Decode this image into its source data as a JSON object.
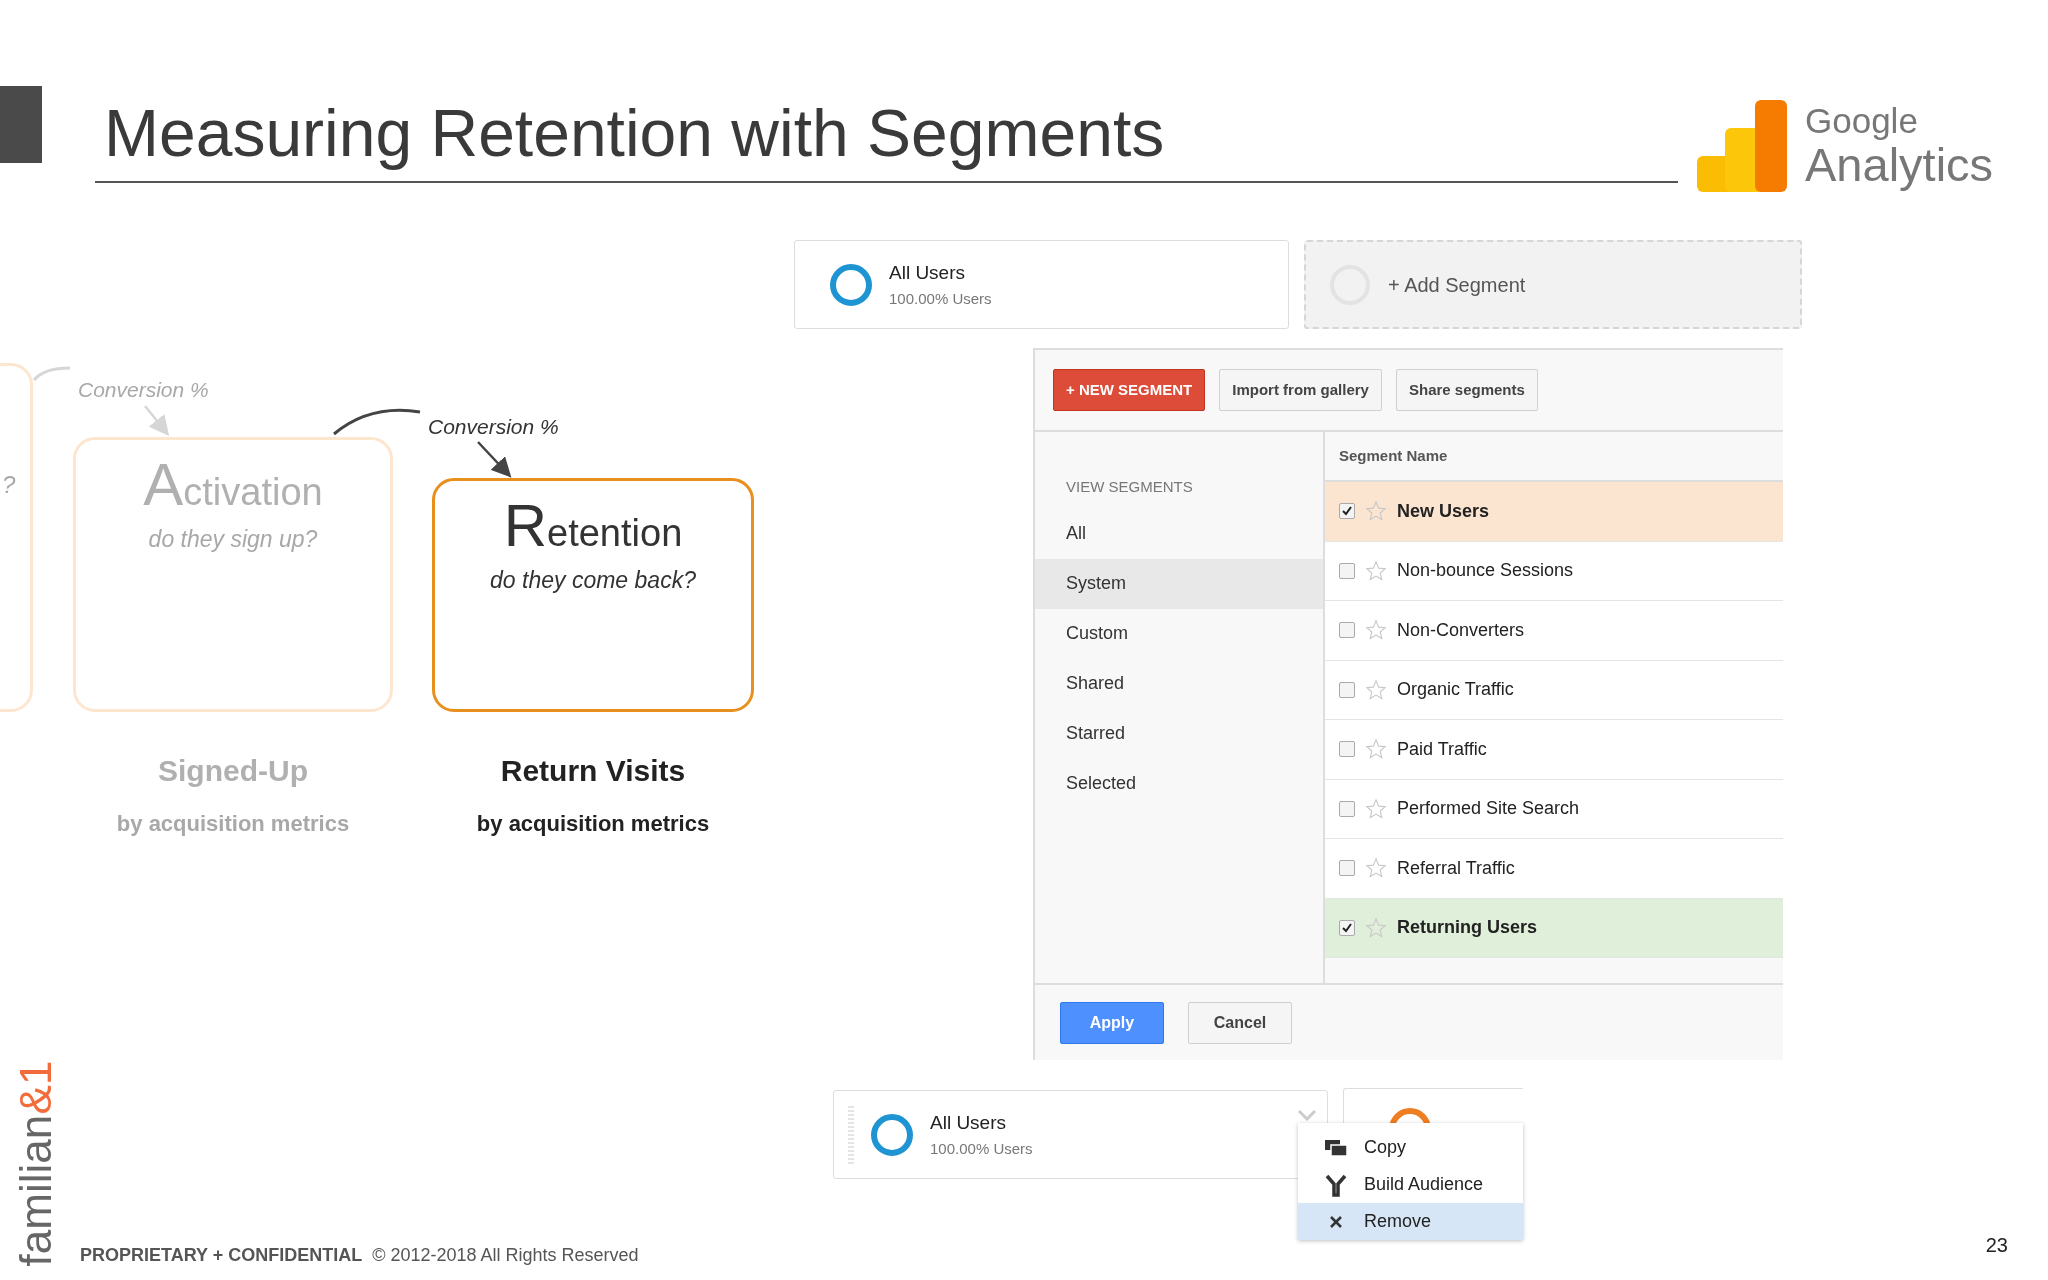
{
  "slide": {
    "title": "Measuring Retention with Segments",
    "page_number": "23",
    "brand": {
      "name": "familian",
      "suffix": "&1"
    },
    "footer": {
      "label": "PROPRIETARY + CONFIDENTIAL",
      "copyright": "© 2012-2018 All Rights Reserved"
    }
  },
  "logo": {
    "line1": "Google",
    "line2": "Analytics"
  },
  "funnel": {
    "edge_text": "?",
    "stages": [
      {
        "title": "Activation",
        "question": "do they sign up?",
        "metric": "Signed-Up",
        "subtitle": "by acquisition metrics",
        "conversion": "Conversion %",
        "faded": true
      },
      {
        "title": "Retention",
        "question": "do they come back?",
        "metric": "Return Visits",
        "subtitle": "by acquisition metrics",
        "conversion": "Conversion %",
        "faded": false
      }
    ]
  },
  "segment_bar": {
    "cards": [
      {
        "kind": "segment",
        "name": "All Users",
        "share": "100.00% Users",
        "color": "#1e94d2"
      },
      {
        "kind": "add",
        "name": "+ Add Segment"
      }
    ]
  },
  "dialog": {
    "toolbar": [
      {
        "label": "+ NEW SEGMENT",
        "kind": "primary"
      },
      {
        "label": "Import from gallery",
        "kind": "secondary"
      },
      {
        "label": "Share segments",
        "kind": "secondary"
      }
    ],
    "nav": {
      "heading": "VIEW SEGMENTS",
      "items": [
        {
          "label": "All",
          "selected": false
        },
        {
          "label": "System",
          "selected": true
        },
        {
          "label": "Custom",
          "selected": false
        },
        {
          "label": "Shared",
          "selected": false
        },
        {
          "label": "Starred",
          "selected": false
        },
        {
          "label": "Selected",
          "selected": false
        }
      ]
    },
    "table": {
      "header": "Segment Name",
      "rows": [
        {
          "name": "New Users",
          "checked": true,
          "color": "#fbe5d0"
        },
        {
          "name": "Non-bounce Sessions",
          "checked": false
        },
        {
          "name": "Non-Converters",
          "checked": false
        },
        {
          "name": "Organic Traffic",
          "checked": false
        },
        {
          "name": "Paid Traffic",
          "checked": false
        },
        {
          "name": "Performed Site Search",
          "checked": false
        },
        {
          "name": "Referral Traffic",
          "checked": false
        },
        {
          "name": "Returning Users",
          "checked": true,
          "color": "#e0efd9"
        }
      ]
    },
    "buttons": [
      {
        "label": "Apply",
        "kind": "primary"
      },
      {
        "label": "Cancel",
        "kind": "secondary"
      }
    ]
  },
  "segment_menu": {
    "card": {
      "name": "All Users",
      "share": "100.00% Users",
      "color": "#1e94d2"
    },
    "items": [
      {
        "label": "Copy",
        "selected": false
      },
      {
        "label": "Build Audience",
        "selected": false
      },
      {
        "label": "Remove",
        "selected": true
      }
    ]
  }
}
